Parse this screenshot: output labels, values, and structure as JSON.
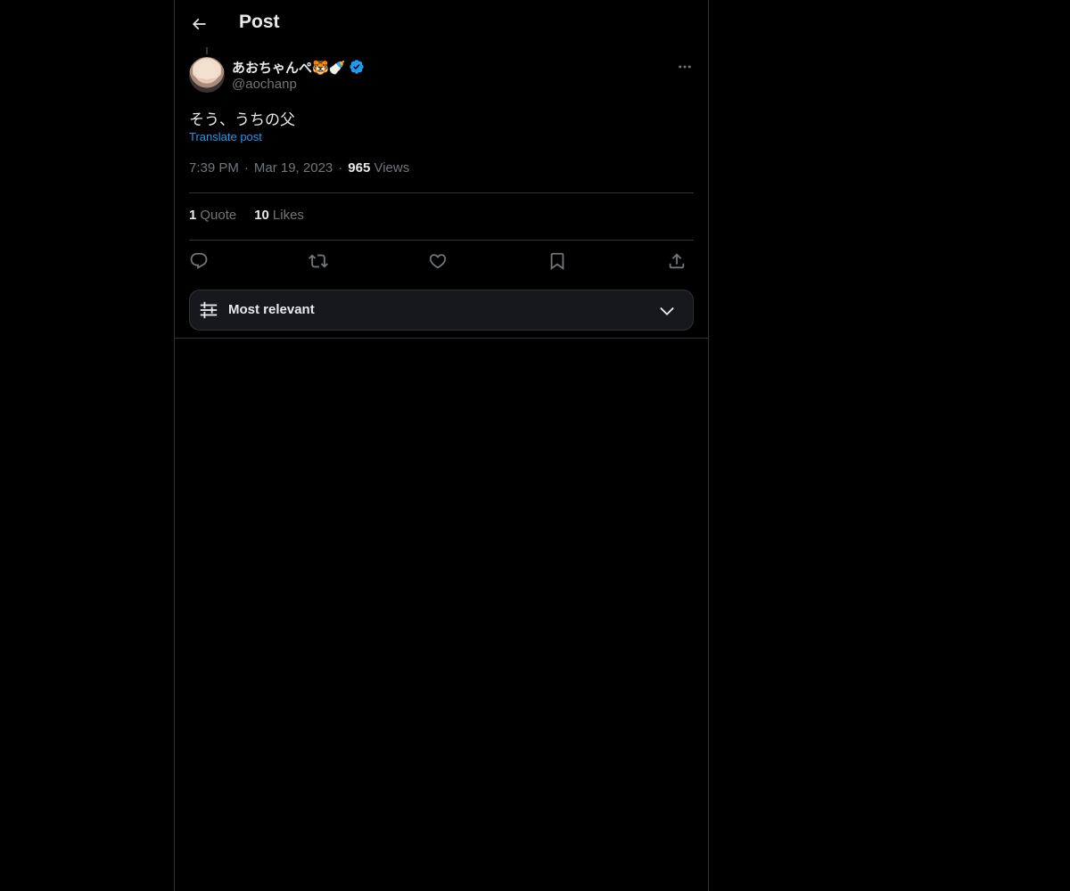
{
  "header": {
    "title": "Post",
    "back_icon": "arrow-left-icon"
  },
  "author": {
    "display_name": "あおちゃんぺ🐯🍼",
    "handle": "@aochanp",
    "verified": true,
    "verified_color": "#1d9bf0",
    "avatar_icon": "avatar"
  },
  "post": {
    "text": "そう、うちの父",
    "translate_label": "Translate post",
    "time": "7:39 PM",
    "separator": "·",
    "date": "Mar 19, 2023",
    "views_count": "965",
    "views_label": "Views"
  },
  "stats": {
    "quotes_count": "1",
    "quotes_label": "Quote",
    "likes_count": "10",
    "likes_label": "Likes"
  },
  "actions": [
    {
      "name": "reply",
      "icon": "reply-icon"
    },
    {
      "name": "repost",
      "icon": "repost-icon"
    },
    {
      "name": "like",
      "icon": "heart-icon"
    },
    {
      "name": "bookmark",
      "icon": "bookmark-icon"
    },
    {
      "name": "share",
      "icon": "share-icon"
    }
  ],
  "replies_sort": {
    "label": "Most relevant",
    "icon": "sliders-icon",
    "chevron": "chevron-down-icon"
  },
  "colors": {
    "background": "#000000",
    "text_primary": "#e7e9ea",
    "text_secondary": "#71767b",
    "accent": "#1d9bf0",
    "border": "#2f3336"
  }
}
